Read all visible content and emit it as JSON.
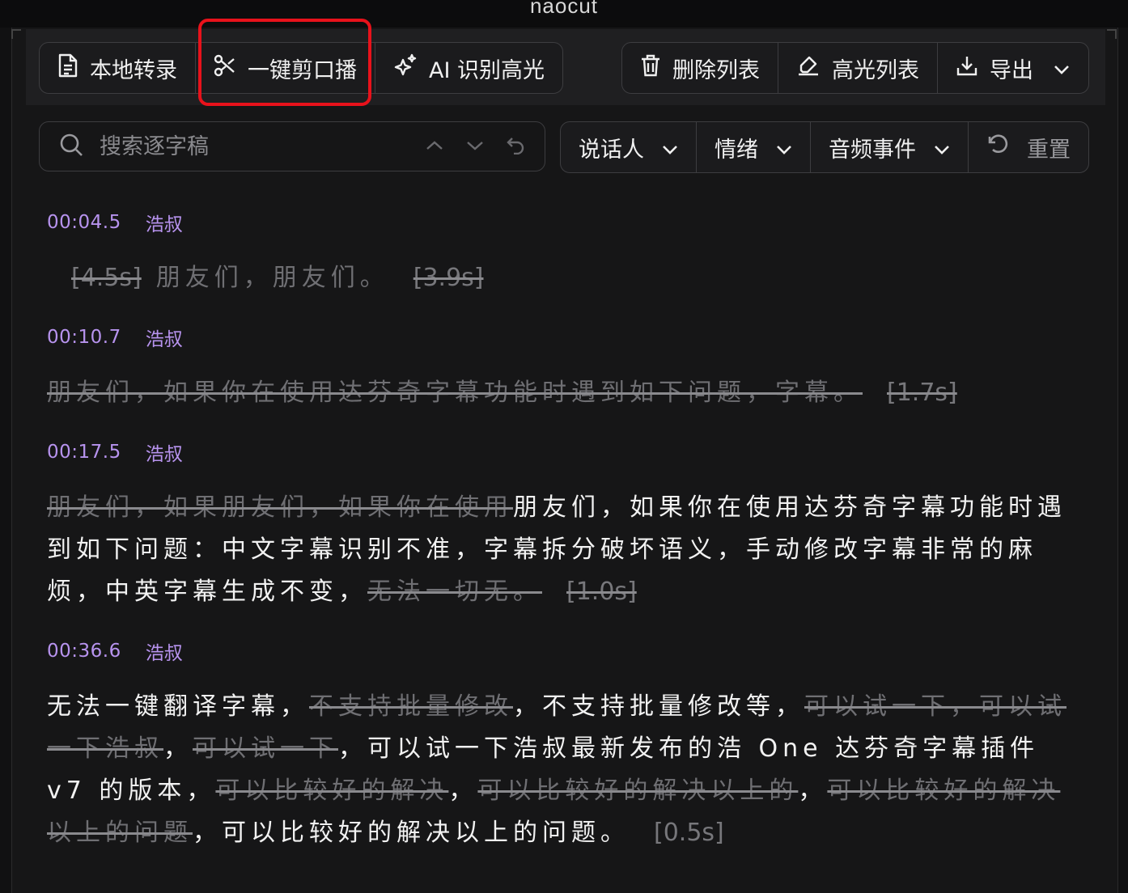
{
  "app": {
    "title": "naocut"
  },
  "toolbar": {
    "local_transcribe": "本地转录",
    "one_click_cut": "一键剪口播",
    "ai_highlight": "AI 识别高光",
    "delete_list": "删除列表",
    "highlight_list": "高光列表",
    "export": "导出"
  },
  "search": {
    "placeholder": "搜索逐字稿"
  },
  "filters": {
    "speaker": "说话人",
    "emotion": "情绪",
    "audio_event": "音频事件",
    "reset": "重置"
  },
  "colors": {
    "accent_purple": "#b793ee",
    "highlight_red": "#e8121b",
    "deleted_gray": "#6f6f73"
  },
  "segments": [
    {
      "time": "00:04.5",
      "speaker": "浩叔",
      "parts": [
        {
          "text": "[4.5s]",
          "deleted": true
        },
        {
          "text": "朋友们，朋友们。",
          "deleted": false,
          "muted": true
        },
        {
          "text": "[3.9s]",
          "deleted": true
        }
      ]
    },
    {
      "time": "00:10.7",
      "speaker": "浩叔",
      "parts": [
        {
          "text": "朋友们，如果你在使用达芬奇字幕功能时遇到如下问题，字幕。",
          "deleted": true
        },
        {
          "text": "[1.7s]",
          "deleted": true
        }
      ]
    },
    {
      "time": "00:17.5",
      "speaker": "浩叔",
      "parts": [
        {
          "text": "朋友们，如果朋友们，如果你在使用",
          "deleted": true
        },
        {
          "text": "朋友们，如果你在使用达芬奇字幕功能时遇到如下问题：中文字幕识别不准，字幕拆分破坏语义，手动修改字幕非常的麻烦，中英字幕生成不变，",
          "deleted": false
        },
        {
          "text": "无法一切无。",
          "deleted": true
        },
        {
          "text": "[1.0s]",
          "deleted": true
        }
      ]
    },
    {
      "time": "00:36.6",
      "speaker": "浩叔",
      "parts": [
        {
          "text": "无法一键翻译字幕，",
          "deleted": false
        },
        {
          "text": "不支持批量修改",
          "deleted": true
        },
        {
          "text": "，不支持批量修改等，",
          "deleted": false
        },
        {
          "text": "可以试一下，可以试一下浩叔",
          "deleted": true
        },
        {
          "text": "，",
          "deleted": false
        },
        {
          "text": "可以试一下",
          "deleted": true
        },
        {
          "text": "，可以试一下浩叔最新发布的浩 One 达芬奇字幕插件 v7 的版本，",
          "deleted": false
        },
        {
          "text": "可以比较好的解决",
          "deleted": true
        },
        {
          "text": "，",
          "deleted": false
        },
        {
          "text": "可以比较好的解决以上的",
          "deleted": true
        },
        {
          "text": "，",
          "deleted": false
        },
        {
          "text": "可以比较好的解决以上的问题",
          "deleted": true
        },
        {
          "text": "，可以比较好的解决以上的问题。",
          "deleted": false
        },
        {
          "text": "[0.5s]",
          "deleted": false,
          "pause": true
        }
      ]
    }
  ]
}
